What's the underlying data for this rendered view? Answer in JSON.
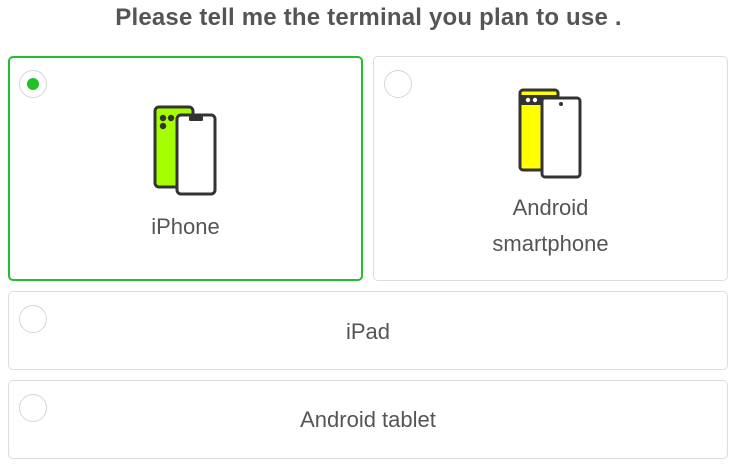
{
  "question": {
    "title": "Please tell me the terminal you plan to use ."
  },
  "options": [
    {
      "label": "iPhone",
      "selected": true,
      "icon": "iphone-icon",
      "icon_color": "#a6ff00"
    },
    {
      "label_line1": "Android",
      "label_line2": "smartphone",
      "selected": false,
      "icon": "android-phone-icon",
      "icon_color": "#ffff00"
    },
    {
      "label": "iPad",
      "selected": false
    },
    {
      "label": "Android tablet",
      "selected": false
    }
  ],
  "colors": {
    "selected_border": "#22c12b",
    "radio_dot": "#1fc224",
    "text": "#555555",
    "card_border": "#dddddd"
  }
}
